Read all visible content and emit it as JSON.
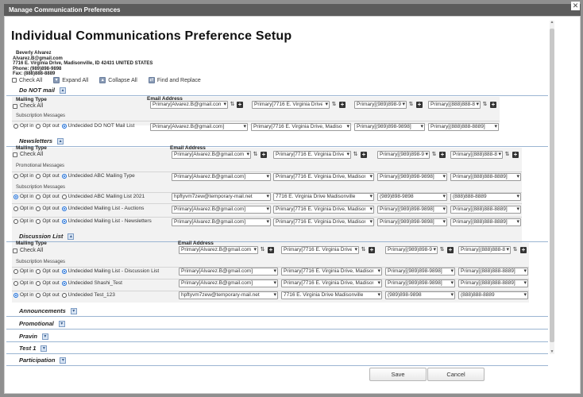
{
  "window": {
    "title": "Manage Communication Preferences",
    "close_glyph": "✕"
  },
  "page_title": "Individual Communications Preference Setup",
  "contact": {
    "name": "Beverly Alvarez",
    "email": "Alvarez.B@gmail.com",
    "address": "7716 E. Virginia Drive, Madisonville, ID 42431 UNITED STATES",
    "phone": "Phone: (989)898-9898",
    "fax": "Fax: (888)888-8889"
  },
  "toolbar": {
    "check_all": "Check All",
    "expand_all": "Expand All",
    "collapse_all": "Collapse All",
    "find_replace": "Find and Replace"
  },
  "labels": {
    "mailing_type": "Mailing Type",
    "email_address": "Email Address",
    "check_all": "Check All",
    "subscription_messages": "Subscription Messages",
    "promotional_messages": "Promotional Messages",
    "opt_in": "Opt in",
    "opt_out": "Opt out",
    "undecided": "Undecided"
  },
  "values": {
    "email_primary": "Primary[Alvarez.B@gmail.com]",
    "address_primary": "Primary[7716 E. Virginia Drive, Madisonville]",
    "phone_primary": "Primary[(989)898-9898]",
    "fax_primary": "Primary[(888)888-8889]",
    "email_alt": "hpftyvm7zew@temporary-mail.net",
    "address_alt": "7716 E. Virginia Drive Madisonville",
    "phone_alt": "(989)898-9898",
    "fax_alt": "(888)888-8889"
  },
  "sections": {
    "do_not_mail": {
      "title": "Do NOT mail",
      "rows": [
        {
          "name": "Undecided DO NOT Mail List",
          "selected": "undecided"
        }
      ]
    },
    "newsletters": {
      "title": "Newsletters",
      "promo_rows": [
        {
          "name": "Undecided ABC Mailing Type",
          "selected": "undecided"
        }
      ],
      "rows": [
        {
          "name": "Undecided ABC Mailing List 2021",
          "selected": "opt_in"
        },
        {
          "name": "Undecided Mailing List - Auctions",
          "selected": "undecided"
        },
        {
          "name": "Undecided Mailing List - Newsletters",
          "selected": "undecided"
        }
      ]
    },
    "discussion_list": {
      "title": "Discussion List",
      "rows": [
        {
          "name": "Undecided Mailing List - Discussion List",
          "selected": "undecided"
        },
        {
          "name": "Undecided Shashi_Test",
          "selected": "undecided"
        },
        {
          "name": "Undecided Test_123",
          "selected": "opt_in"
        }
      ]
    }
  },
  "collapsed_sections": [
    "Announcements",
    "Promotional",
    "Pravin",
    "Test 1",
    "Participation"
  ],
  "footer": {
    "save": "Save",
    "cancel": "Cancel"
  }
}
